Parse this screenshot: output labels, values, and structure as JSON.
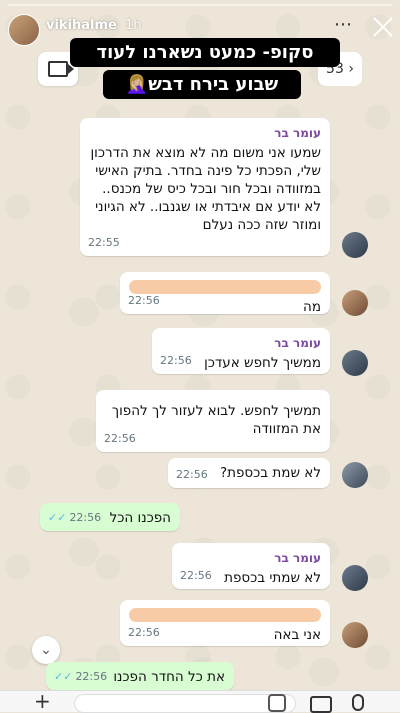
{
  "story": {
    "username": "vikihalme",
    "time": "1h",
    "overlay_line1": "סקופ- כמעט נשארנו לעוד",
    "overlay_line2": "שבוע בירח דבש🤦🏼‍♀️",
    "counter": "53"
  },
  "messages": [
    {
      "sender": "עומר בר",
      "text": "שמעו אני משום מה לא מוצא את הדרכון שלי, הפכתי כל פינה בחדר. בתיק האישי במזוודה ובכל חור ובכל כיס של מכנס.. לא יודע אם איבדתי או שגנבו.. לא הגיוני ומוזר שזה ככה נעלם",
      "time": "22:55"
    },
    {
      "sender": "",
      "text": "מה",
      "time": "22:56"
    },
    {
      "sender": "עומר בר",
      "text": "ממשיך לחפש אעדכן",
      "time": "22:56"
    },
    {
      "sender": "",
      "text": "תמשיך לחפש. לבוא לעזור לך להפוך את המזוודה",
      "time": "22:56"
    },
    {
      "sender": "",
      "text": "לא שמת בכספת?",
      "time": "22:56"
    },
    {
      "sender": "",
      "text": "הפכנו הכל",
      "time": "22:56"
    },
    {
      "sender": "עומר בר",
      "text": "לא שמתי בכספת",
      "time": "22:56"
    },
    {
      "sender": "",
      "text": "אני באה",
      "time": "22:56"
    },
    {
      "sender": "",
      "text": "את כל החדר הפכנו",
      "time": "22:56"
    }
  ],
  "icons": {
    "close": "close-icon",
    "more": "more-icon",
    "video": "video-call-icon",
    "scroll": "chevron-down-icon",
    "plus": "plus-icon",
    "sticker": "sticker-icon",
    "camera": "camera-icon",
    "mic": "mic-icon"
  },
  "colors": {
    "sent_bubble": "#d9fdd3",
    "received_bubble": "#ffffff",
    "sender_name": "#7b4aa0",
    "read_ticks": "#53bdeb"
  }
}
